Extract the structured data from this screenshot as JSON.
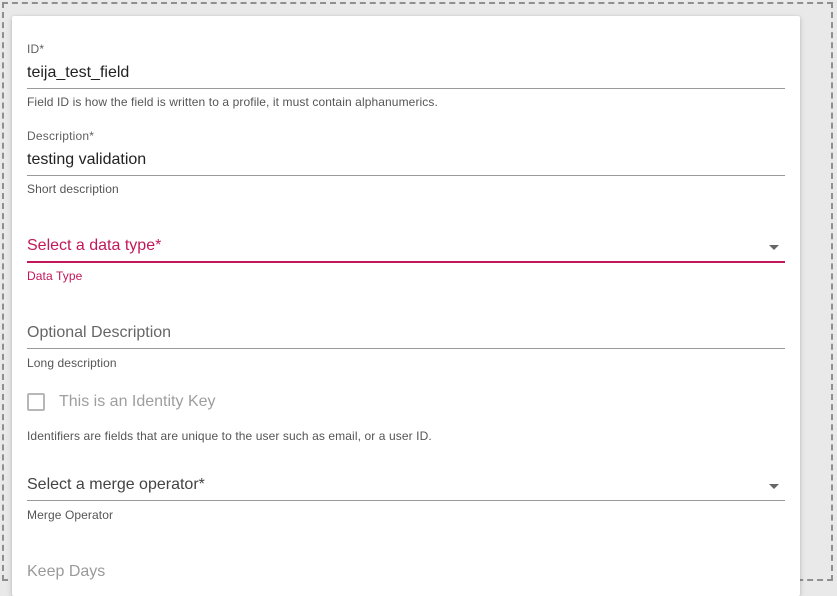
{
  "form": {
    "id_field": {
      "label": "ID*",
      "value": "teija_test_field",
      "hint": "Field ID is how the field is written to a profile, it must contain alphanumerics."
    },
    "description_field": {
      "label": "Description*",
      "value": "testing validation",
      "hint": "Short description"
    },
    "data_type_select": {
      "placeholder": "Select a data type*",
      "hint": "Data Type",
      "state_color": "#c2185b"
    },
    "optional_description_field": {
      "placeholder": "Optional Description",
      "hint": "Long description"
    },
    "identity_key_checkbox": {
      "label": "This is an Identity Key",
      "checked": false,
      "hint": "Identifiers are fields that are unique to the user such as email, or a user ID."
    },
    "merge_operator_select": {
      "placeholder": "Select a merge operator*",
      "hint": "Merge Operator"
    },
    "keep_days_field": {
      "placeholder": "Keep Days"
    }
  },
  "icons": {
    "dropdown_arrow": "chevron-down-icon"
  }
}
